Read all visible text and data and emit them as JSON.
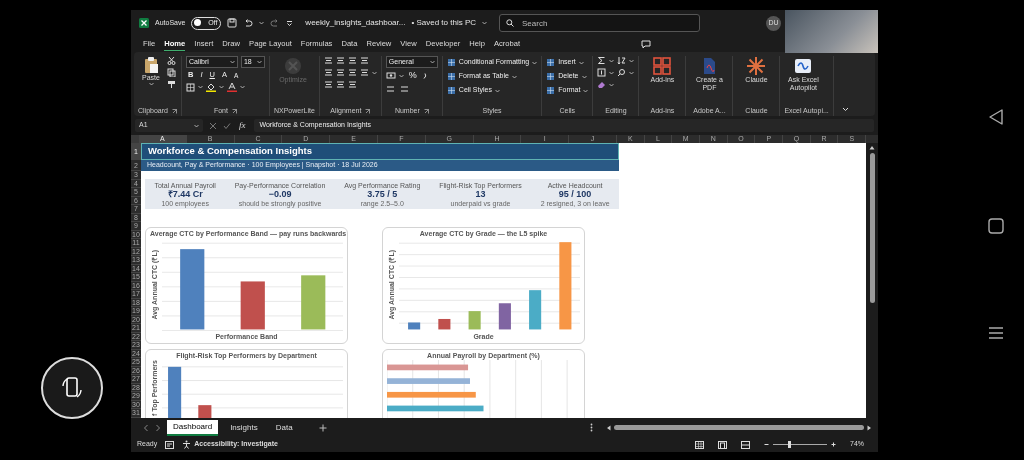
{
  "title_bar": {
    "autosave_label": "AutoSave",
    "autosave": {
      "on": false,
      "label": "Off"
    },
    "file_name": "weekly_insights_dashboar...",
    "save_status": "• Saved to this PC",
    "search": {
      "placeholder": "Search"
    },
    "user_initials": "DU"
  },
  "menu_tabs": [
    {
      "label": "File",
      "selected": false
    },
    {
      "label": "Home",
      "selected": true
    },
    {
      "label": "Insert",
      "selected": false
    },
    {
      "label": "Draw",
      "selected": false
    },
    {
      "label": "Page Layout",
      "selected": false
    },
    {
      "label": "Formulas",
      "selected": false
    },
    {
      "label": "Data",
      "selected": false
    },
    {
      "label": "Review",
      "selected": false
    },
    {
      "label": "View",
      "selected": false
    },
    {
      "label": "Developer",
      "selected": false
    },
    {
      "label": "Help",
      "selected": false
    },
    {
      "label": "Acrobat",
      "selected": false
    }
  ],
  "ribbon": {
    "groups": [
      {
        "name": "Clipboard",
        "kind": "clipboard",
        "big": "Paste",
        "disabled": false
      },
      {
        "name": "Font",
        "kind": "font",
        "font": "Calibri",
        "size": "18",
        "styles": [
          "B",
          "I",
          "U"
        ],
        "grow": [
          "A",
          "A"
        ],
        "disabled": false
      },
      {
        "name": "NXPowerLite",
        "kind": "big",
        "big": "Optimize",
        "disabled": true
      },
      {
        "name": "Alignment",
        "kind": "alignment",
        "disabled": false
      },
      {
        "name": "Number",
        "kind": "number",
        "format": "General",
        "percent": "%",
        "disabled": false
      },
      {
        "name": "Styles",
        "kind": "list",
        "items": [
          "Conditional Formatting",
          "Format as Table",
          "Cell Styles"
        ],
        "disabled": false
      },
      {
        "name": "Cells",
        "kind": "list",
        "items": [
          "Insert",
          "Delete",
          "Format"
        ],
        "disabled": false
      },
      {
        "name": "Editing",
        "kind": "editing",
        "disabled": false
      },
      {
        "name": "Add-ins",
        "kind": "big",
        "big": "Add-ins",
        "disabled": false
      },
      {
        "name": "Adobe A...",
        "kind": "big",
        "big": "Create a PDF",
        "disabled": false
      },
      {
        "name": "Claude",
        "kind": "big",
        "big": "Claude",
        "disabled": false
      },
      {
        "name": "Excel Autopi...",
        "kind": "big",
        "big": "Ask Excel Autopilot",
        "disabled": false
      }
    ]
  },
  "formula_bar": {
    "name_box": "A1",
    "function_label": "fx",
    "formula": "Workforce & Compensation Insights"
  },
  "sheet": {
    "columns": [
      "A",
      "B",
      "C",
      "D",
      "E",
      "F",
      "G",
      "H",
      "I",
      "J",
      "K",
      "L",
      "M",
      "N",
      "O",
      "P",
      "Q",
      "R",
      "S"
    ],
    "rows": [
      "1",
      "2",
      "3",
      "4",
      "5",
      "6",
      "7",
      "8",
      "9",
      "10",
      "11",
      "12",
      "13",
      "14",
      "15",
      "16",
      "17",
      "18",
      "19",
      "20",
      "21",
      "22",
      "23",
      "24",
      "25",
      "26",
      "27",
      "28",
      "29",
      "30",
      "31"
    ],
    "title": "Workforce & Compensation Insights",
    "subtitle": "Headcount, Pay & Performance · 100 Employees | Snapshot · 18 Jul 2026",
    "kpis": [
      {
        "label": "Total Annual Payroll",
        "value": "₹7.44 Cr",
        "note": "100 employees"
      },
      {
        "label": "Pay-Performance Correlation",
        "value": "−0.09",
        "note": "should be strongly positive"
      },
      {
        "label": "Avg Performance Rating",
        "value": "3.75 / 5",
        "note": "range 2.5–5.0"
      },
      {
        "label": "Flight-Risk Top Performers",
        "value": "13",
        "note": "underpaid vs grade"
      },
      {
        "label": "Active Headcount",
        "value": "95 / 100",
        "note": "2 resigned, 3 on leave"
      }
    ],
    "charts": [
      {
        "title": "Average CTC by Performance Band — pay runs backwards",
        "ylabel": "Avg Annual CTC (₹L)",
        "xlabel": "Performance Band",
        "kind": "column"
      },
      {
        "title": "Average CTC by Grade — the L5 spike",
        "ylabel": "Avg Annual CTC (₹L)",
        "xlabel": "Grade",
        "kind": "column"
      },
      {
        "title": "Flight-Risk Top Performers by Department",
        "ylabel": "f Top Performers",
        "kind": "column"
      },
      {
        "title": "Annual Payroll by Department (%)",
        "kind": "bar"
      }
    ]
  },
  "sheet_tabs": [
    {
      "label": "Dashboard",
      "selected": true
    },
    {
      "label": "Insights",
      "selected": false
    },
    {
      "label": "Data",
      "selected": false
    }
  ],
  "status_bar": {
    "status": "Ready",
    "accessibility": "Accessibility: Investigate",
    "zoom": {
      "level": 0.3,
      "label": "74%"
    }
  }
}
